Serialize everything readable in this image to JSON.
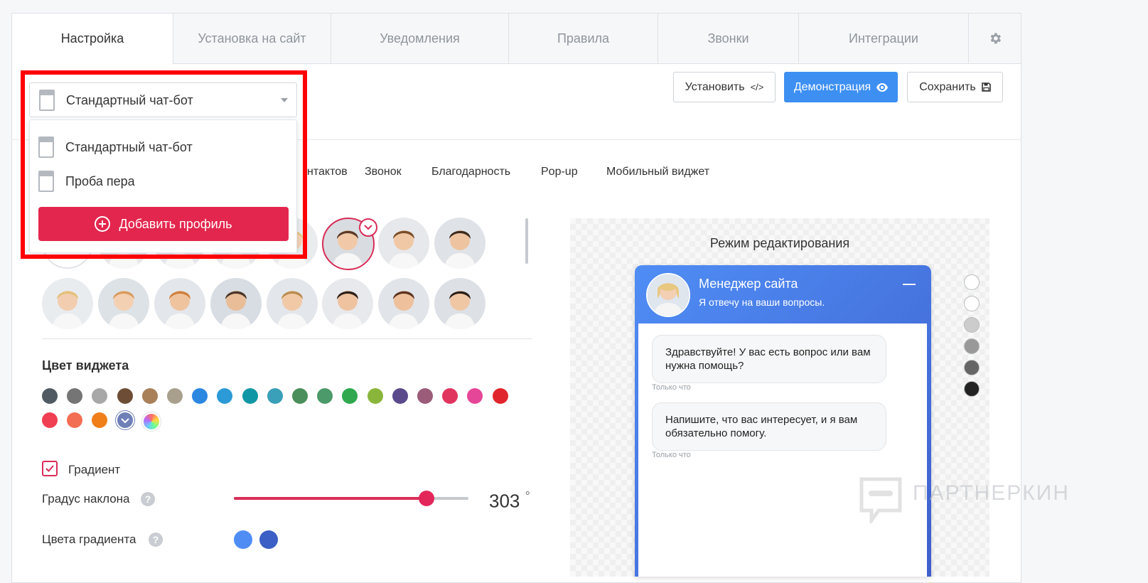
{
  "tabs": [
    {
      "label": "Настройка",
      "active": true
    },
    {
      "label": "Установка на сайт",
      "active": false
    },
    {
      "label": "Уведомления",
      "active": false
    },
    {
      "label": "Правила",
      "active": false
    },
    {
      "label": "Звонки",
      "active": false
    },
    {
      "label": "Интеграции",
      "active": false
    }
  ],
  "settings_icon": "gear-icon",
  "toolbar": {
    "install_label": "Установить",
    "install_icon": "code-icon",
    "demo_label": "Демонстрация",
    "demo_icon": "eye-icon",
    "save_label": "Сохранить",
    "save_icon": "floppy-disk-icon"
  },
  "profile_select": {
    "selected": "Стандартный чат-бот",
    "options": [
      "Стандартный чат-бот",
      "Проба пера"
    ],
    "add_label": "Добавить профиль"
  },
  "subtabs": [
    "нтактов",
    "Звонок",
    "Благодарность",
    "Pop-up",
    "Мобильный виджет"
  ],
  "widget_color": {
    "title": "Цвет виджета",
    "swatches": [
      "#4f5a63",
      "#757575",
      "#a8a8a8",
      "#6e4d36",
      "#a8805a",
      "#a8a08c",
      "#2c87e0",
      "#2b9ad6",
      "#0f97a6",
      "#3a9fb8",
      "#4a8f5c",
      "#4c9a6a",
      "#2fa84f",
      "#8ab53b",
      "#5a4a8c",
      "#9b5c7a",
      "#e0355f",
      "#e64697",
      "#e0262c",
      "#f03e52",
      "#f36f53",
      "#f07f1a",
      "#6f7fb8",
      "#multicolor"
    ],
    "selected_index": 22
  },
  "gradient": {
    "label": "Градиент",
    "checked": true,
    "angle_label": "Градус наклона",
    "angle_value": "303",
    "angle_unit": "°",
    "angle_fraction": 0.82,
    "colors_label": "Цвета градиента",
    "colors": [
      "#4f8df5",
      "#3b5fc4"
    ]
  },
  "preview": {
    "mode_title": "Режим редактирования",
    "chat_title": "Менеджер сайта",
    "chat_subtitle": "Я отвечу на ваши вопросы.",
    "messages": [
      {
        "text": "Здравствуйте! У вас есть вопрос или вам нужна помощь?",
        "time": "Только что"
      },
      {
        "text": "Напишите, что вас интересует, и я вам обязательно помогу.",
        "time": "Только что"
      }
    ],
    "mode_dots": [
      "#ffffff",
      "#ffffff",
      "#cccccc",
      "#999999",
      "#666666",
      "#222222"
    ]
  },
  "watermark": "ПАРТНЕРКИН"
}
